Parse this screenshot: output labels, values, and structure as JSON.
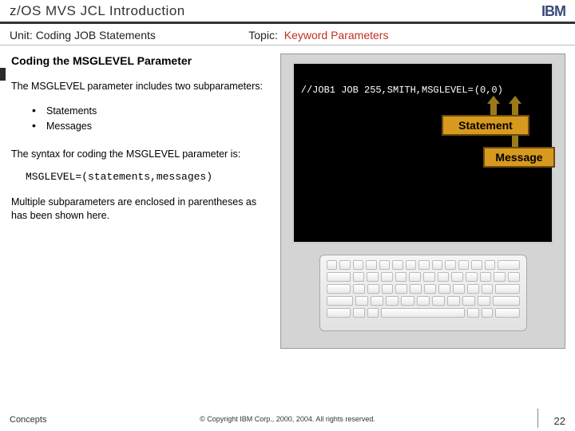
{
  "header": {
    "title": "z/OS MVS JCL Introduction",
    "logo_text": "IBM"
  },
  "subheader": {
    "unit_label": "Unit:",
    "unit_value": "Coding JOB Statements",
    "topic_label": "Topic:",
    "topic_value": "Keyword Parameters"
  },
  "body": {
    "heading": "Coding the MSGLEVEL Parameter",
    "intro": "The MSGLEVEL parameter includes two subparameters:",
    "bullets": [
      "Statements",
      "Messages"
    ],
    "syntax_lead": "The syntax for coding the MSGLEVEL parameter is:",
    "syntax_code": "MSGLEVEL=(statements,messages)",
    "closing": "Multiple subparameters are enclosed in parentheses as has been shown here."
  },
  "screen": {
    "code_prefix": "//JOB1 JOB 255,SMITH,MSGLEVEL=",
    "code_pair": "(0,0)",
    "callout_statement": "Statement",
    "callout_message": "Message"
  },
  "footer": {
    "left": "Concepts",
    "center": "© Copyright IBM Corp., 2000, 2004. All rights reserved.",
    "page": "22"
  }
}
